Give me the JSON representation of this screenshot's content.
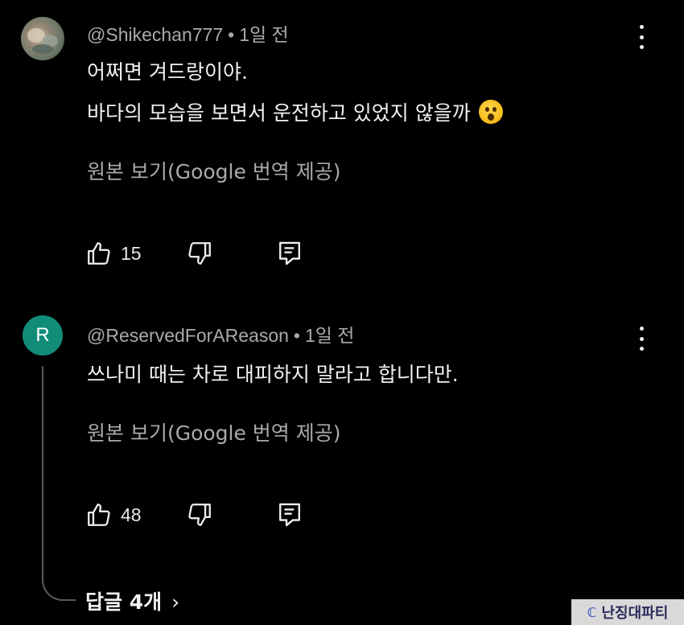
{
  "comments": [
    {
      "handle": "@Shikechan777",
      "separator": "•",
      "time": "1일 전",
      "lines": [
        "어쩌면 겨드랑이야.",
        "바다의 모습을 보면서 운전하고 있었지 않을까"
      ],
      "emoji": "hushed-face-emoji",
      "translate_label": "원본 보기(Google 번역 제공)",
      "like_count": "15"
    },
    {
      "avatar_letter": "R",
      "avatar_color": "#118c79",
      "handle": "@ReservedForAReason",
      "separator": "•",
      "time": "1일 전",
      "lines": [
        "쓰나미 때는 차로 대피하지 말라고 합니다만."
      ],
      "translate_label": "원본 보기(Google 번역 제공)",
      "like_count": "48"
    }
  ],
  "replies_label": "답글 4개",
  "replies_chevron": "›",
  "watermark": {
    "logo": "ℂ",
    "text": "난징대파티"
  }
}
